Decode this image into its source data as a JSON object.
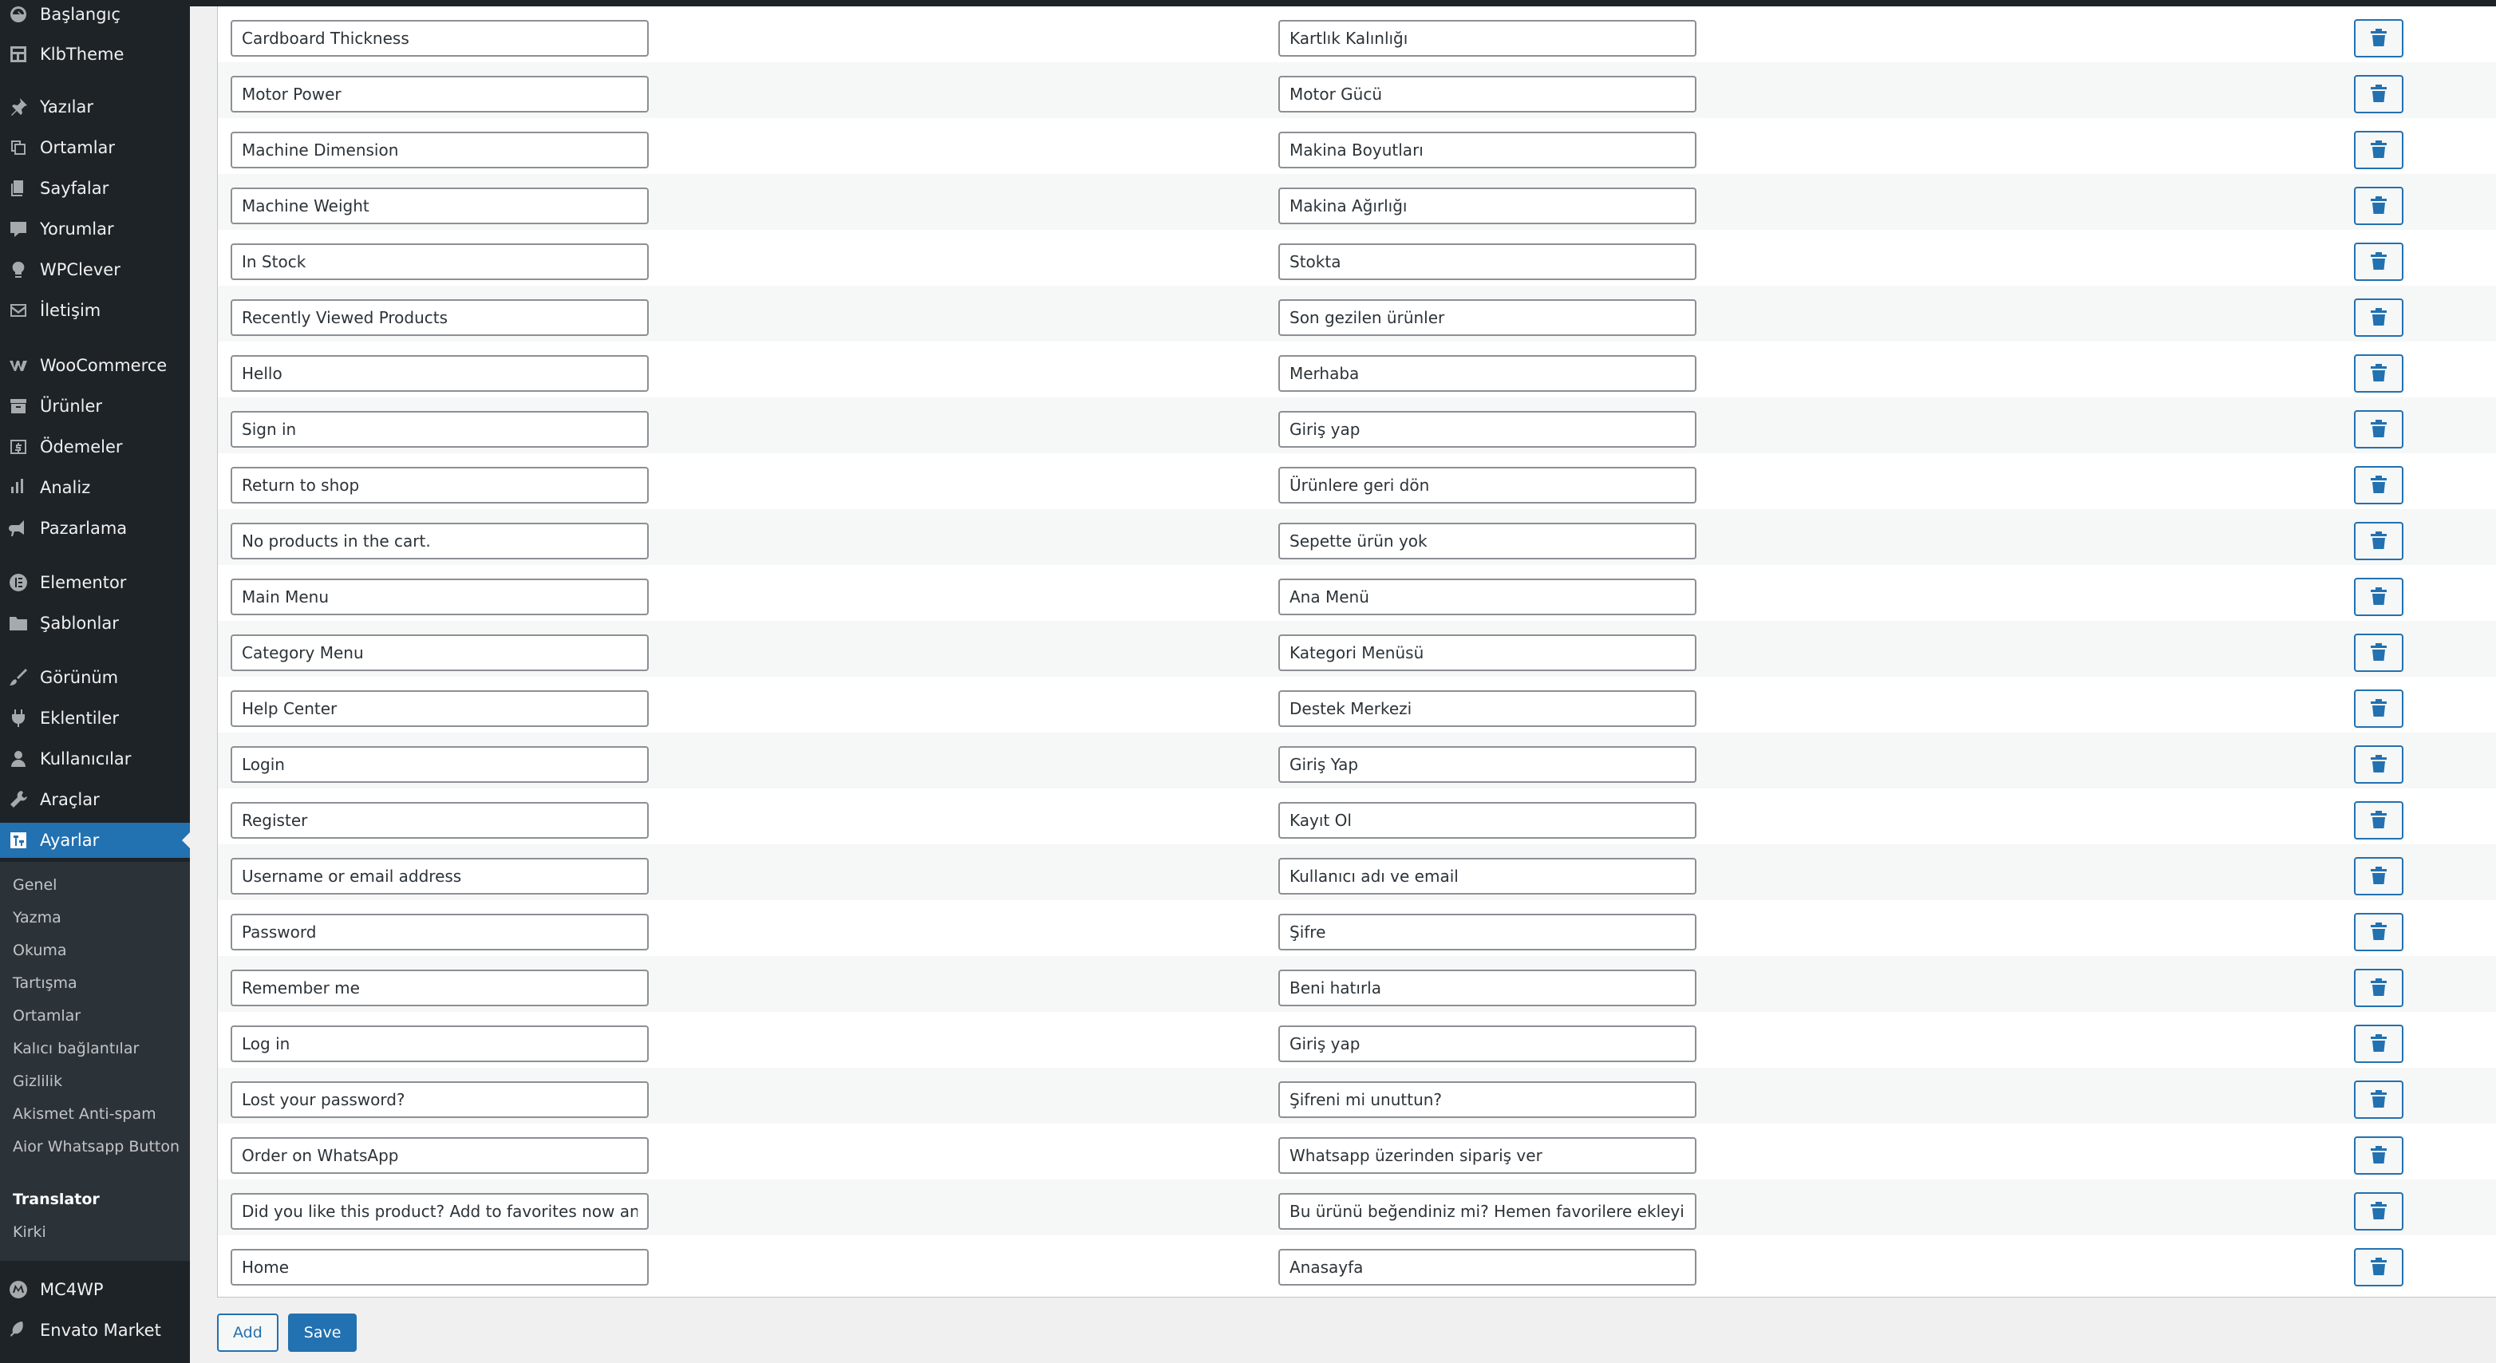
{
  "sidebar": {
    "items": [
      {
        "label": "Başlangıç",
        "icon": "dashboard-icon"
      },
      {
        "label": "KlbTheme",
        "icon": "grid-icon"
      },
      {
        "label": "Yazılar",
        "icon": "pin-icon"
      },
      {
        "label": "Ortamlar",
        "icon": "media-icon"
      },
      {
        "label": "Sayfalar",
        "icon": "pages-icon"
      },
      {
        "label": "Yorumlar",
        "icon": "comment-icon"
      },
      {
        "label": "WPClever",
        "icon": "bulb-icon"
      },
      {
        "label": "İletişim",
        "icon": "mail-icon"
      },
      {
        "label": "WooCommerce",
        "icon": "woocommerce-icon"
      },
      {
        "label": "Ürünler",
        "icon": "archive-icon"
      },
      {
        "label": "Ödemeler",
        "icon": "dollar-icon"
      },
      {
        "label": "Analiz",
        "icon": "bar-chart-icon"
      },
      {
        "label": "Pazarlama",
        "icon": "megaphone-icon"
      },
      {
        "label": "Elementor",
        "icon": "elementor-icon"
      },
      {
        "label": "Şablonlar",
        "icon": "folder-icon"
      },
      {
        "label": "Görünüm",
        "icon": "brush-icon"
      },
      {
        "label": "Eklentiler",
        "icon": "plugin-icon"
      },
      {
        "label": "Kullanıcılar",
        "icon": "user-icon"
      },
      {
        "label": "Araçlar",
        "icon": "wrench-icon"
      },
      {
        "label": "Ayarlar",
        "icon": "settings-icon"
      },
      {
        "label": "MC4WP",
        "icon": "mc4wp-icon"
      },
      {
        "label": "Envato Market",
        "icon": "envato-icon"
      }
    ],
    "submenu": [
      "Genel",
      "Yazma",
      "Okuma",
      "Tartışma",
      "Ortamlar",
      "Kalıcı bağlantılar",
      "Gizlilik",
      "Akismet Anti-spam",
      "Aior Whatsapp Button",
      "Translator",
      "Kirki"
    ],
    "current": "Ayarlar",
    "active_sub": "Translator"
  },
  "rows": [
    {
      "source": "Cardboard Thickness",
      "translation": "Kartlık Kalınlığı"
    },
    {
      "source": "Motor Power",
      "translation": "Motor Gücü"
    },
    {
      "source": "Machine Dimension",
      "translation": "Makina Boyutları"
    },
    {
      "source": "Machine Weight",
      "translation": "Makina Ağırlığı"
    },
    {
      "source": "In Stock",
      "translation": "Stokta"
    },
    {
      "source": "Recently Viewed Products",
      "translation": "Son gezilen ürünler"
    },
    {
      "source": "Hello",
      "translation": "Merhaba"
    },
    {
      "source": "Sign in",
      "translation": "Giriş yap"
    },
    {
      "source": "Return to shop",
      "translation": "Ürünlere geri dön"
    },
    {
      "source": "No products in the cart.",
      "translation": "Sepette ürün yok"
    },
    {
      "source": "Main Menu",
      "translation": "Ana Menü"
    },
    {
      "source": "Category Menu",
      "translation": "Kategori Menüsü"
    },
    {
      "source": "Help Center",
      "translation": "Destek Merkezi"
    },
    {
      "source": "Login",
      "translation": "Giriş Yap"
    },
    {
      "source": "Register",
      "translation": "Kayıt Ol"
    },
    {
      "source": "Username or email address",
      "translation": "Kullanıcı adı ve email"
    },
    {
      "source": "Password",
      "translation": "Şifre"
    },
    {
      "source": "Remember me",
      "translation": "Beni hatırla"
    },
    {
      "source": "Log in",
      "translation": "Giriş yap"
    },
    {
      "source": "Lost your password?",
      "translation": "Şifreni mi unuttun?"
    },
    {
      "source": "Order on WhatsApp",
      "translation": "Whatsapp üzerinden sipariş ver"
    },
    {
      "source": "Did you like this product? Add to favorites now an",
      "translation": "Bu ürünü beğendiniz mi? Hemen favorilere ekleyir"
    },
    {
      "source": "Home",
      "translation": "Anasayfa"
    }
  ],
  "actions": {
    "add_label": "Add",
    "save_label": "Save"
  },
  "colors": {
    "sidebar_bg": "#1d2327",
    "submenu_bg": "#2c3338",
    "accent": "#2271b1",
    "page_bg": "#f0f0f1"
  }
}
